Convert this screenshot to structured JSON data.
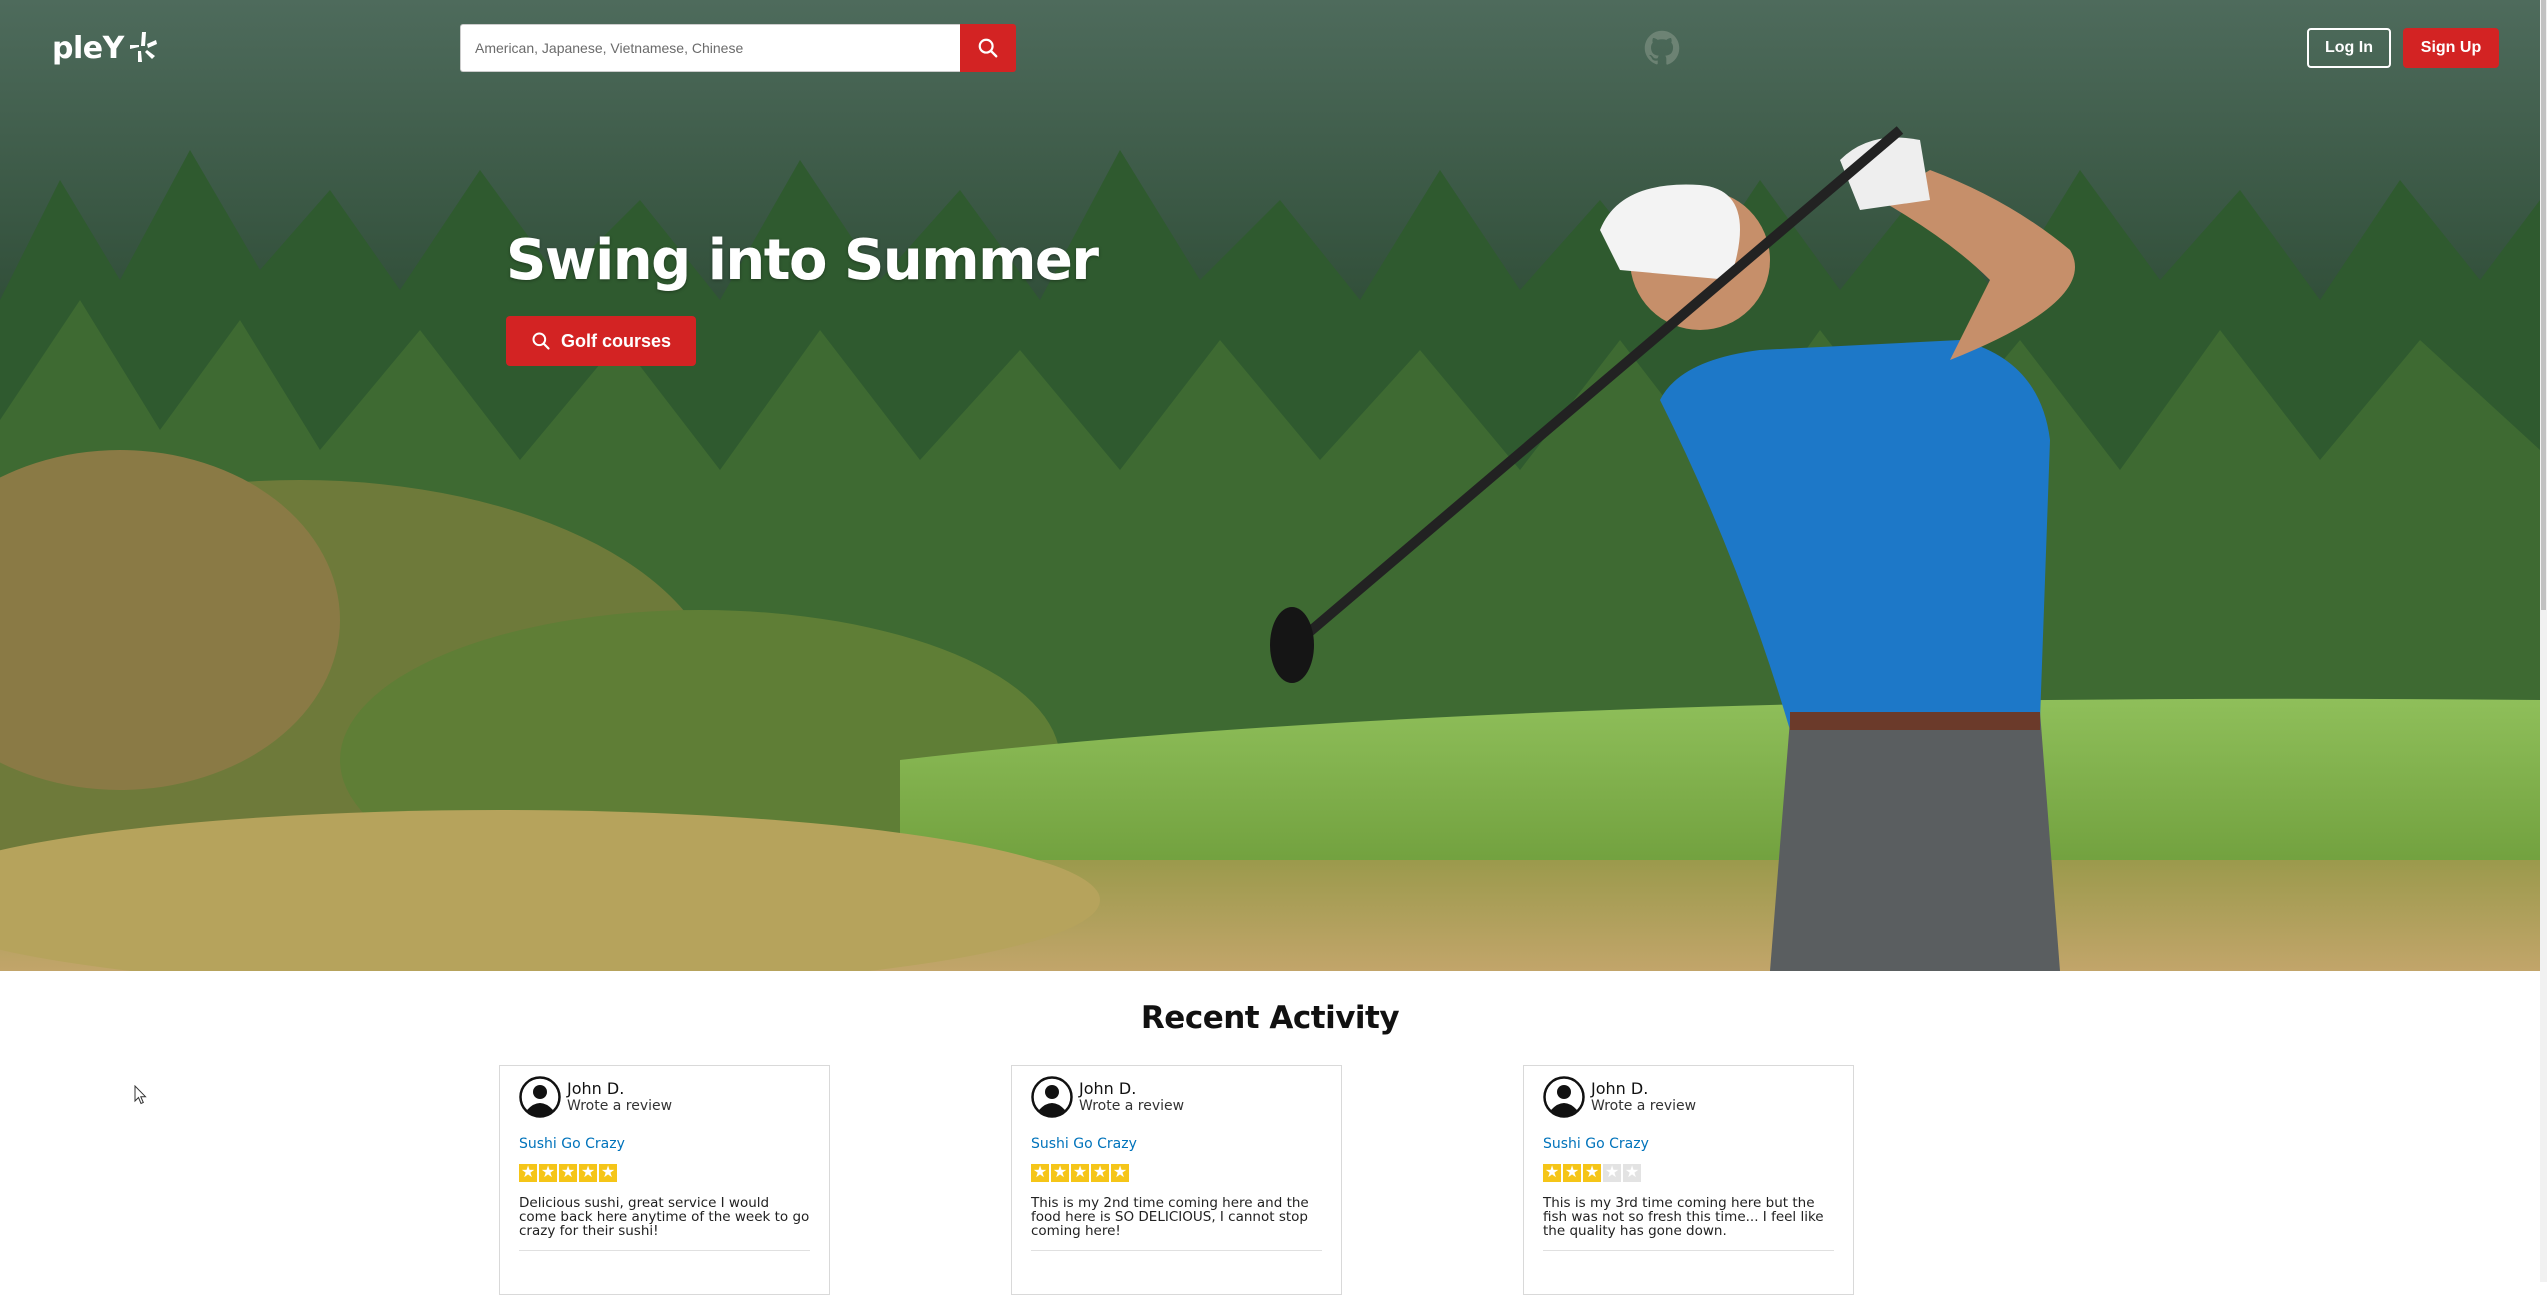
{
  "header": {
    "logo_text": "pleY",
    "search": {
      "placeholder": "American, Japanese, Vietnamese, Chinese",
      "value": ""
    },
    "login_label": "Log In",
    "signup_label": "Sign Up"
  },
  "hero": {
    "title": "Swing into Summer",
    "cta_label": "Golf courses"
  },
  "activity": {
    "section_title": "Recent Activity",
    "cards": [
      {
        "user": "John D.",
        "action": "Wrote a review",
        "business": "Sushi Go Crazy",
        "rating": 5,
        "text": "Delicious sushi, great service I would come back here anytime of the week to go crazy for their sushi!"
      },
      {
        "user": "John D.",
        "action": "Wrote a review",
        "business": "Sushi Go Crazy",
        "rating": 5,
        "text": "This is my 2nd time coming here and the food here is SO DELICIOUS, I cannot stop coming here!"
      },
      {
        "user": "John D.",
        "action": "Wrote a review",
        "business": "Sushi Go Crazy",
        "rating": 3,
        "text": "This is my 3rd time coming here but the fish was not so fresh this time... I feel like the quality has gone down."
      }
    ]
  },
  "icons": {
    "logo": "yelp-burst-icon",
    "search": "search-icon",
    "github": "github-icon",
    "avatar": "user-avatar-icon",
    "star": "star-icon"
  },
  "colors": {
    "brand_red": "#d32323",
    "star_yellow": "#f5c518",
    "star_empty": "#e3e3e3",
    "link_blue": "#0073bb"
  }
}
